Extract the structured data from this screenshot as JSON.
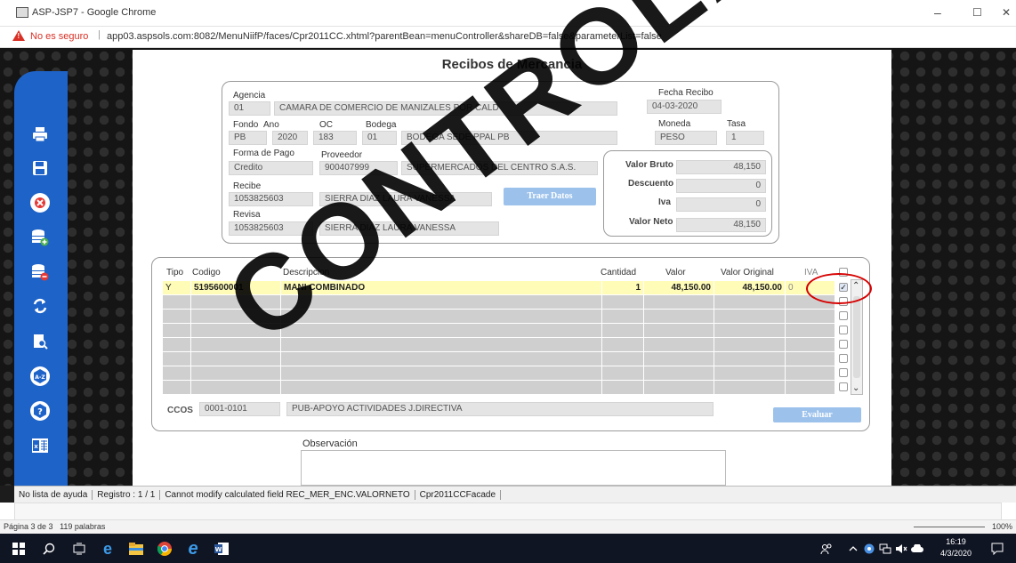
{
  "window": {
    "title": "ASP-JSP7 - Google Chrome",
    "minimize": "–",
    "maximize": "☐",
    "close": "✕"
  },
  "address": {
    "insecure": "No es seguro",
    "url": "app03.aspsols.com:8082/MenuNiifP/faces/Cpr2011CC.xhtml?parentBean=menuController&shareDB=false&parameterList=false"
  },
  "form": {
    "title": "Recibos de Mercancia",
    "agencia_label": "Agencia",
    "agencia_code": "01",
    "agencia_name": "CAMARA DE COMERCIO DE MANIZALES POR CALD",
    "fecha_label": "Fecha Recibo",
    "fecha_value": "04-03-2020",
    "fondo_label": "Fondo",
    "fondo_value": "PB",
    "ano_label": "Ano",
    "ano_value": "2020",
    "oc_label": "OC",
    "oc_value": "183",
    "bodega_label": "Bodega",
    "bodega_code": "01",
    "bodega_name": "BODEGA SEDE PPAL PB",
    "moneda_label": "Moneda",
    "moneda_value": "PESO",
    "tasa_label": "Tasa",
    "tasa_value": "1",
    "forma_pago_label": "Forma de Pago",
    "forma_pago_value": "Credito",
    "proveedor_label": "Proveedor",
    "proveedor_nit": "900407999",
    "proveedor_name": "SUPERMERCADOS DEL CENTRO S.A.S.",
    "recibe_label": "Recibe",
    "recibe_id": "1053825603",
    "recibe_name": "SIERRA DIAZ LAURA VANESSA",
    "revisa_label": "Revisa",
    "revisa_id": "1053825603",
    "revisa_name": "SIERRA DIAZ LAURA VANESSA",
    "traer_datos": "Traer Datos",
    "valor_bruto_label": "Valor Bruto",
    "valor_bruto": "48,150",
    "descuento_label": "Descuento",
    "descuento": "0",
    "iva_label": "Iva",
    "iva": "0",
    "valor_neto_label": "Valor Neto",
    "valor_neto": "48,150"
  },
  "grid": {
    "headers": {
      "tipo": "Tipo",
      "codigo": "Codigo",
      "descripcion": "Descripcion",
      "cantidad": "Cantidad",
      "valor": "Valor",
      "valor_original": "Valor Original",
      "iva": "IVA"
    },
    "row1": {
      "tipo": "Y",
      "codigo": "5195600001",
      "descripcion": "MANI COMBINADO",
      "cantidad": "1",
      "valor": "48,150.00",
      "valor_original": "48,150.00",
      "iva": "0"
    },
    "ccos_label": "CCOS",
    "ccos_code": "0001-0101",
    "ccos_name": "PUB-APOYO ACTIVIDADES J.DIRECTIVA",
    "evaluar": "Evaluar",
    "observacion_label": "Observación"
  },
  "statusbar": {
    "help": "No lista de ayuda",
    "registro": "Registro : 1 / 1",
    "message": "Cannot modify calculated field REC_MER_ENC.VALORNETO",
    "facade": "Cpr2011CCFacade"
  },
  "word": {
    "page": "Página 3 de 3",
    "words": "119 palabras",
    "zoom": "100%"
  },
  "taskbar": {
    "time": "16:19",
    "date": "4/3/2020"
  },
  "watermark": "CONTROLADA"
}
